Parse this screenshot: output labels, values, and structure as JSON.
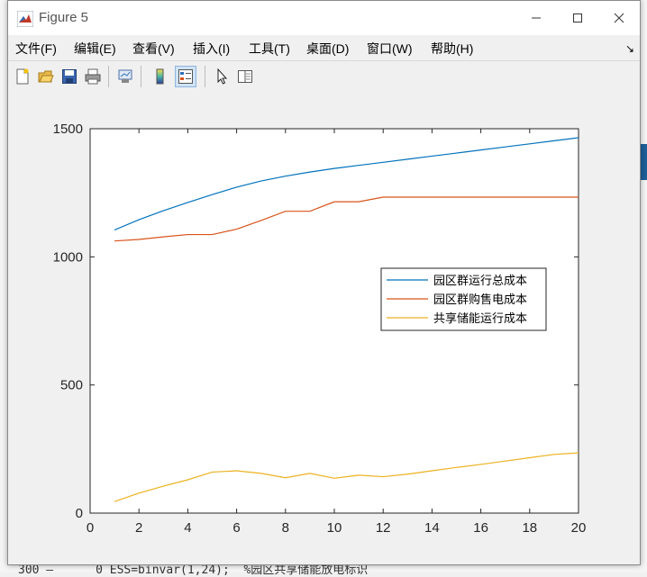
{
  "window": {
    "title": "Figure 5"
  },
  "menu": [
    "文件(F)",
    "编辑(E)",
    "查看(V)",
    "插入(I)",
    "工具(T)",
    "桌面(D)",
    "窗口(W)",
    "帮助(H)"
  ],
  "toolbar_icons": [
    "new-figure-icon",
    "open-file-icon",
    "save-icon",
    "print-icon",
    "link-axes-icon",
    "colorbar-icon",
    "legend-icon",
    "pointer-icon",
    "property-editor-icon"
  ],
  "background_text": {
    "code_line": "300 —      0 ESS=binvar(1,24);  %园区共享储能放电标识"
  },
  "chart_data": {
    "type": "line",
    "x": [
      1,
      2,
      3,
      4,
      5,
      6,
      7,
      8,
      9,
      10,
      11,
      12,
      13,
      14,
      15,
      16,
      17,
      18,
      19,
      20
    ],
    "xlim": [
      0,
      20
    ],
    "ylim": [
      0,
      1500
    ],
    "xticks": [
      0,
      2,
      4,
      6,
      8,
      10,
      12,
      14,
      16,
      18,
      20
    ],
    "yticks": [
      0,
      500,
      1000,
      1500
    ],
    "series": [
      {
        "name": "园区群运行总成本",
        "color": "#0072BD",
        "values": [
          1105,
          1145,
          1180,
          1212,
          1243,
          1272,
          1296,
          1315,
          1331,
          1345,
          1357,
          1369,
          1381,
          1393,
          1405,
          1417,
          1429,
          1441,
          1453,
          1465
        ]
      },
      {
        "name": "园区群购售电成本",
        "color": "#D95319",
        "values": [
          1062,
          1068,
          1078,
          1087,
          1087,
          1108,
          1142,
          1178,
          1178,
          1215,
          1215,
          1233,
          1233,
          1233,
          1233,
          1233,
          1233,
          1233,
          1233,
          1233
        ]
      },
      {
        "name": "共享储能运行成本",
        "color": "#EDB120",
        "values": [
          45,
          78,
          105,
          130,
          160,
          165,
          155,
          138,
          155,
          136,
          148,
          142,
          152,
          165,
          178,
          190,
          203,
          216,
          229,
          235
        ]
      }
    ],
    "legend": "center-right",
    "grid": false
  }
}
